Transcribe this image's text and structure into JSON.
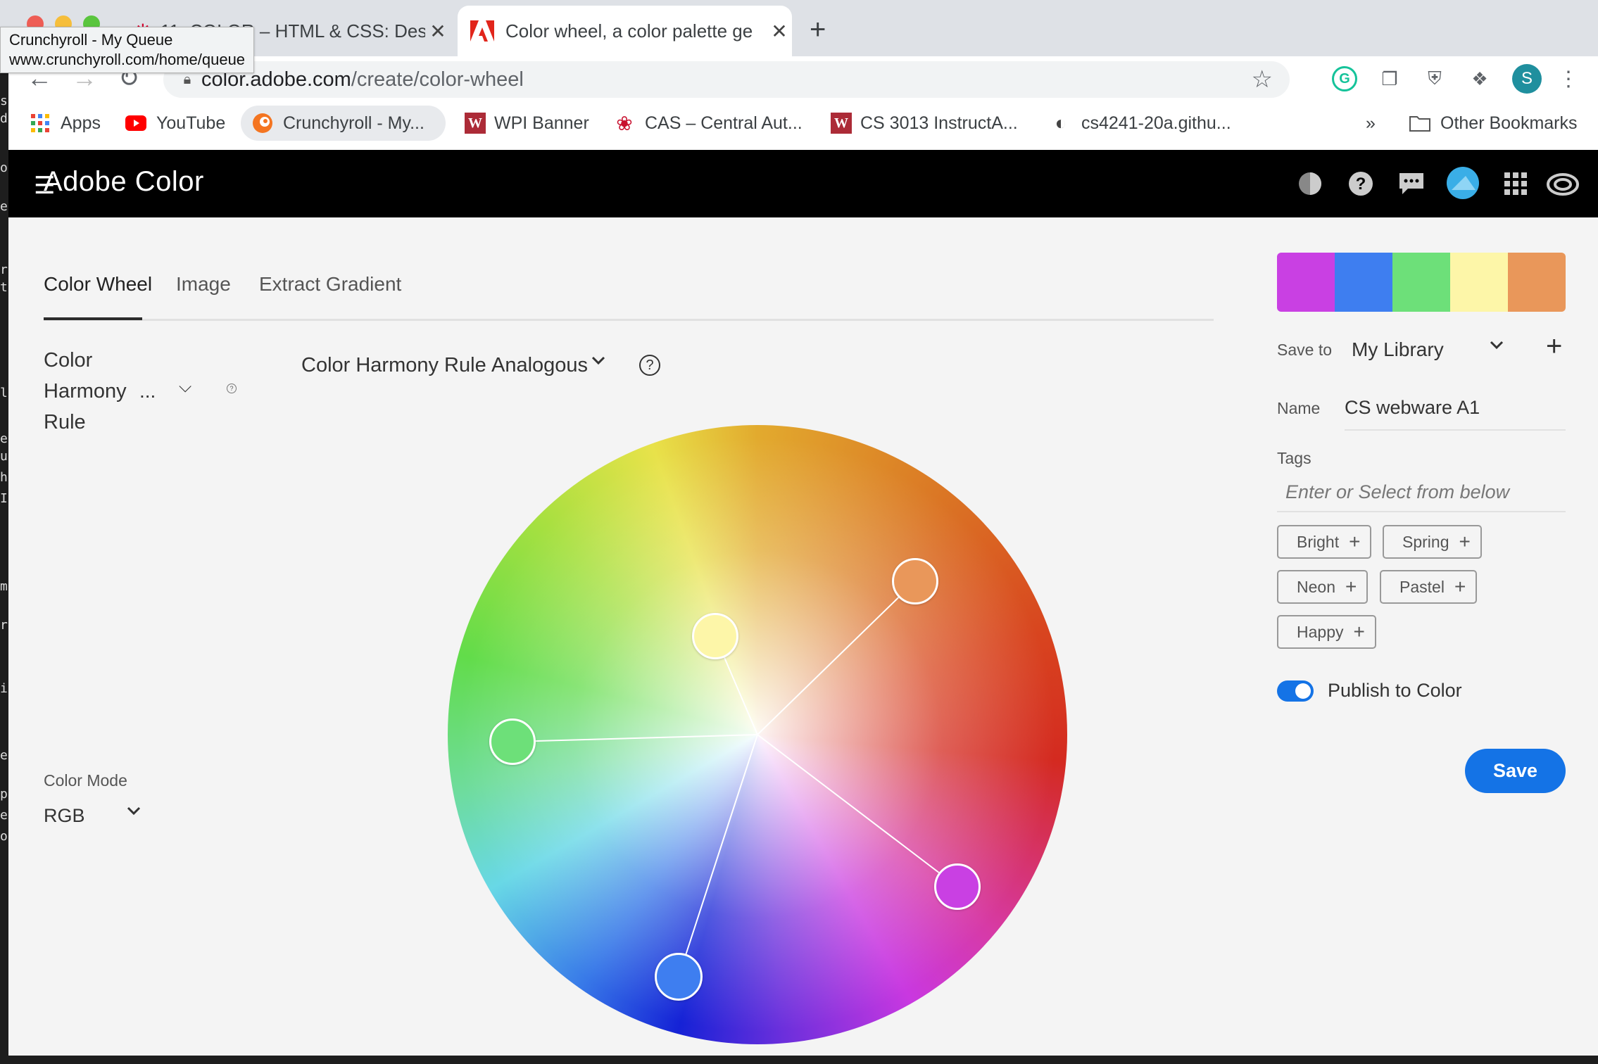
{
  "browser": {
    "tabs": [
      {
        "title": "11: COLOR – HTML & CSS: Des",
        "close": "✕"
      },
      {
        "title": "Color wheel, a color palette ge",
        "close": "✕"
      }
    ],
    "new_tab": "+",
    "tooltip": {
      "title": "Crunchyroll - My Queue",
      "url": "www.crunchyroll.com/home/queue"
    },
    "url": {
      "host": "color.adobe.com",
      "path": "/create/color-wheel"
    },
    "profile_initial": "S",
    "bookmarks": [
      {
        "label": "Apps",
        "icon": "apps-grid-icon"
      },
      {
        "label": "YouTube",
        "icon": "youtube-icon"
      },
      {
        "label": "Crunchyroll - My...",
        "icon": "crunchyroll-icon"
      },
      {
        "label": "WPI Banner",
        "icon": "wpi-icon"
      },
      {
        "label": "CAS – Central Aut...",
        "icon": "cas-icon"
      },
      {
        "label": "CS 3013 InstructA...",
        "icon": "wpi-icon"
      },
      {
        "label": "cs4241-20a.githu...",
        "icon": "globe-icon"
      }
    ],
    "bookmarks_overflow": "»",
    "other_bookmarks": "Other Bookmarks",
    "wpi_letter": "W"
  },
  "app": {
    "title": "Adobe Color",
    "hamburger": "☰"
  },
  "tabs": {
    "wheel": "Color Wheel",
    "image": "Image",
    "gradient": "Extract Gradient"
  },
  "sidebar": {
    "harmony_line1": "Color",
    "harmony_line2": "Harmony",
    "harmony_line3": "Rule",
    "harmony_ellipsis": "...",
    "mode_label": "Color Mode",
    "mode_value": "RGB"
  },
  "harmony": {
    "label": "Color Harmony Rule",
    "value": "Analogous",
    "help": "?"
  },
  "palette": {
    "colors": [
      "#c940e3",
      "#3e7ef0",
      "#6de079",
      "#fdf6a8",
      "#e9975a"
    ]
  },
  "panel": {
    "saveto_label": "Save to",
    "saveto_value": "My Library",
    "add": "+",
    "name_label": "Name",
    "name_value": "CS webware A1",
    "tags_label": "Tags",
    "tags_placeholder": "Enter or Select from below",
    "tags": [
      "Bright",
      "Spring",
      "Neon",
      "Pastel",
      "Happy"
    ],
    "tag_plus": "+",
    "publish_label": "Publish to Color",
    "publish_on": true,
    "save": "Save"
  }
}
